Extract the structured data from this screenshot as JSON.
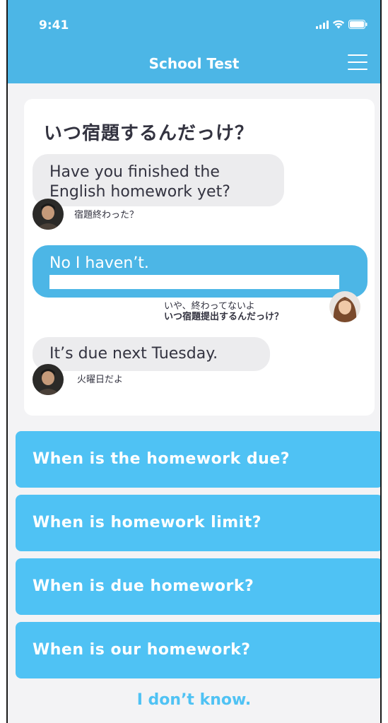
{
  "status_bar": {
    "time": "9:41"
  },
  "header": {
    "title": "School Test"
  },
  "card": {
    "title": "いつ宿題するんだっけ？",
    "messages": [
      {
        "speaker": "boy",
        "text_line1": "Have you finished the",
        "text_line2": "English homework yet?",
        "caption": "宿題終わった？"
      },
      {
        "speaker": "girl",
        "text": "No I haven’t.",
        "caption_line1": "いや、終わってないよ",
        "caption_line2": "いつ宿題提出するんだっけ？"
      },
      {
        "speaker": "boy",
        "text": "It’s due next Tuesday.",
        "caption": "火曜日だよ"
      }
    ]
  },
  "answers": [
    "When is the homework due?",
    "When is homework limit?",
    "When is due homework?",
    "When is our homework?"
  ],
  "dont_know": "I don’t know.",
  "colors": {
    "header_bg": "#4cb6e6",
    "answer_bg": "#4fc2f4",
    "page_bg": "#f3f3f5"
  }
}
